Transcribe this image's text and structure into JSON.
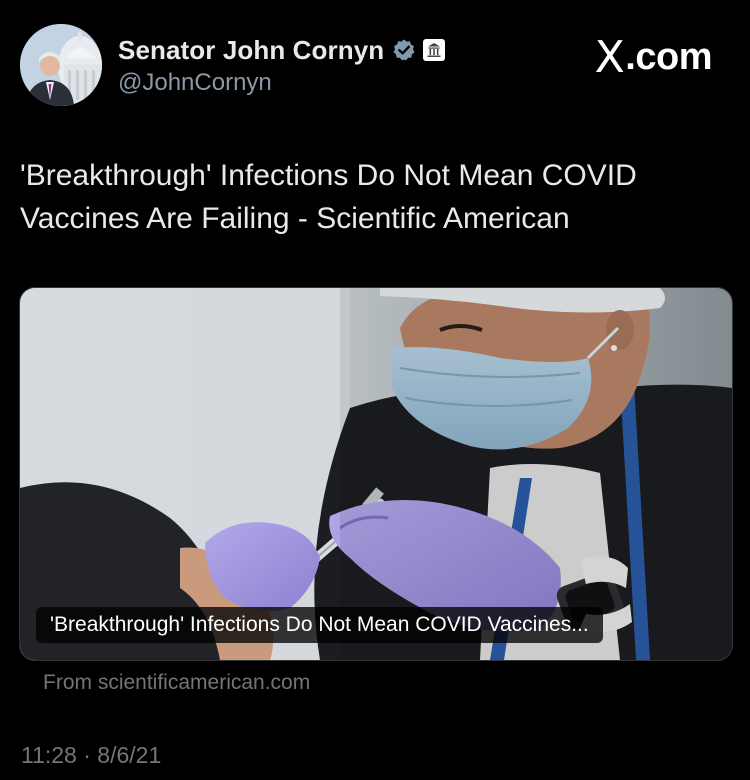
{
  "author": {
    "name": "Senator John Cornyn",
    "handle": "@JohnCornyn",
    "verified_icon": "verified-badge-icon",
    "affiliation_icon": "government-building-icon"
  },
  "brand": {
    "label": "X.com",
    "x_glyph": "X",
    "suffix": ".com"
  },
  "tweet": {
    "text": "'Breakthrough' Infections Do Not Mean COVID Vaccines Are Failing - Scientific American"
  },
  "card": {
    "title": "'Breakthrough' Infections Do Not Mean COVID Vaccines...",
    "source": "From scientificamerican.com",
    "image_icon": "vaccination-photo"
  },
  "meta": {
    "timestamp": "11:28 · 8/6/21"
  },
  "colors": {
    "background": "#000000",
    "text_primary": "#e7e9ea",
    "text_secondary": "#71767b",
    "verified": "#829aab",
    "card_border": "#2f3336"
  }
}
